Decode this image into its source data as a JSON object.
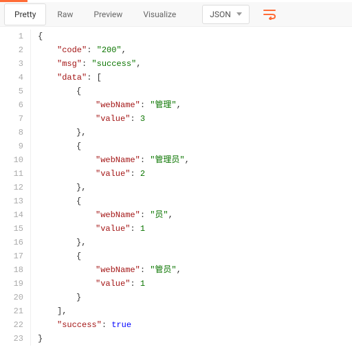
{
  "toolbar": {
    "tabs": {
      "pretty": "Pretty",
      "raw": "Raw",
      "preview": "Preview",
      "visualize": "Visualize"
    },
    "format_dropdown": "JSON"
  },
  "code": {
    "line_numbers": [
      "1",
      "2",
      "3",
      "4",
      "5",
      "6",
      "7",
      "8",
      "9",
      "10",
      "11",
      "12",
      "13",
      "14",
      "15",
      "16",
      "17",
      "18",
      "19",
      "20",
      "21",
      "22",
      "23"
    ],
    "json": {
      "code_key": "code",
      "code_value": "200",
      "msg_key": "msg",
      "msg_value": "success",
      "data_key": "data",
      "webName_key": "webName",
      "value_key": "value",
      "items": [
        {
          "webName": "管理",
          "value": "3"
        },
        {
          "webName": "管理员",
          "value": "2"
        },
        {
          "webName": "员",
          "value": "1"
        },
        {
          "webName": "管员",
          "value": "1"
        }
      ],
      "success_key": "success",
      "success_value": "true"
    }
  }
}
